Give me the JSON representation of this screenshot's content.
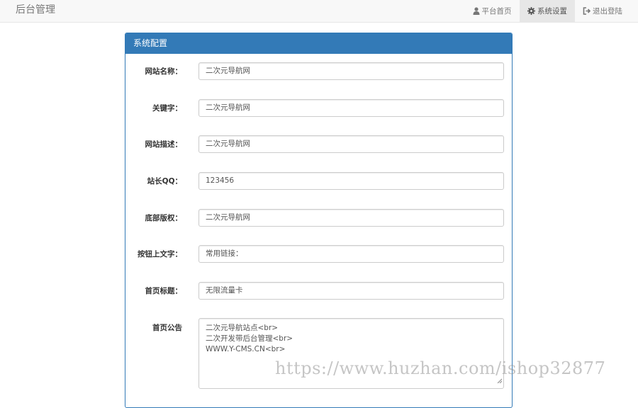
{
  "navbar": {
    "brand": "后台管理",
    "items": [
      {
        "label": "平台首页",
        "icon": "user-icon",
        "active": false
      },
      {
        "label": "系统设置",
        "icon": "gear-icon",
        "active": true
      },
      {
        "label": "退出登陆",
        "icon": "logout-icon",
        "active": false
      }
    ]
  },
  "panel": {
    "title": "系统配置",
    "fields": [
      {
        "label": "网站名称：",
        "value": "二次元导航网"
      },
      {
        "label": "关键字：",
        "value": "二次元导航网"
      },
      {
        "label": "网站描述：",
        "value": "二次元导航网"
      },
      {
        "label": "站长QQ：",
        "value": "123456"
      },
      {
        "label": "底部版权：",
        "value": "二次元导航网"
      },
      {
        "label": "按钮上文字：",
        "value": "常用链接："
      },
      {
        "label": "首页标题：",
        "value": "无限流量卡"
      }
    ],
    "notice": {
      "label": "首页公告",
      "lines": [
        "二次元导航站点<br>",
        "二次开发带后台管理<br>",
        "WWW.Y-CMS.CN<br>"
      ]
    }
  },
  "watermark": "https://www.huzhan.com/ishop32877",
  "colors": {
    "primary": "#337ab7",
    "navbar_bg": "#f8f8f8",
    "active_nav_bg": "#e7e7e7"
  }
}
